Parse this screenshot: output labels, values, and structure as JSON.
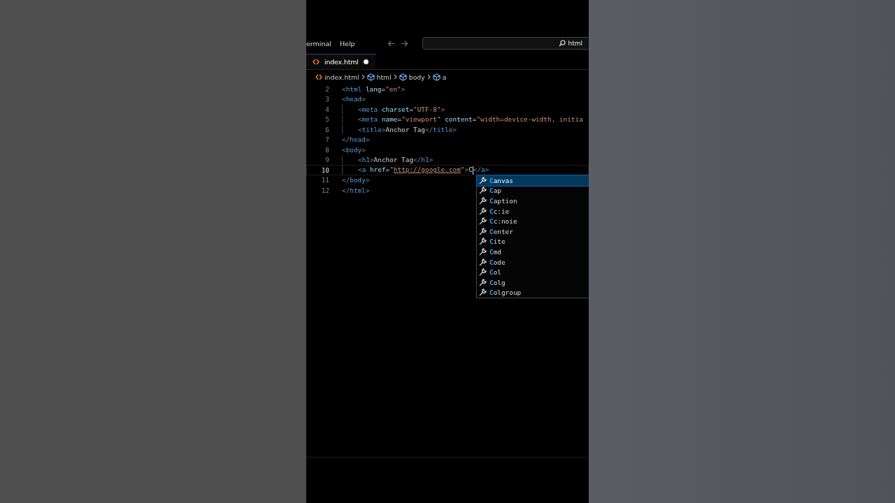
{
  "menu_bar": {
    "items": [
      "erminal",
      "Help"
    ],
    "search": {
      "value": "html"
    }
  },
  "tabs": [
    {
      "label": "index.html",
      "selected": true,
      "modified": true
    }
  ],
  "breadcrumb": [
    {
      "label": "index.html",
      "kind": "file"
    },
    {
      "label": "html",
      "kind": "element"
    },
    {
      "label": "body",
      "kind": "element"
    },
    {
      "label": "a",
      "kind": "element"
    }
  ],
  "code_lines": [
    {
      "number": "2",
      "indent": false,
      "current": false,
      "tokens": [
        {
          "text": "<",
          "kind": "punct"
        },
        {
          "text": "html",
          "kind": "tag"
        },
        {
          "text": " lang",
          "kind": "attr"
        },
        {
          "text": "=",
          "kind": "text"
        },
        {
          "text": "\"en\"",
          "kind": "string"
        },
        {
          "text": ">",
          "kind": "punct"
        }
      ]
    },
    {
      "number": "3",
      "indent": false,
      "current": false,
      "tokens": [
        {
          "text": "<",
          "kind": "punct"
        },
        {
          "text": "head",
          "kind": "tag"
        },
        {
          "text": ">",
          "kind": "punct"
        }
      ]
    },
    {
      "number": "4",
      "indent": true,
      "current": false,
      "tokens": [
        {
          "text": "<",
          "kind": "punct"
        },
        {
          "text": "meta",
          "kind": "tag"
        },
        {
          "text": " charset",
          "kind": "attr"
        },
        {
          "text": "=",
          "kind": "text"
        },
        {
          "text": "\"UTF-8\"",
          "kind": "string"
        },
        {
          "text": ">",
          "kind": "punct"
        }
      ]
    },
    {
      "number": "5",
      "indent": true,
      "current": false,
      "tokens": [
        {
          "text": "<",
          "kind": "punct"
        },
        {
          "text": "meta",
          "kind": "tag"
        },
        {
          "text": " name",
          "kind": "attr"
        },
        {
          "text": "=",
          "kind": "text"
        },
        {
          "text": "\"viewport\"",
          "kind": "string"
        },
        {
          "text": " content",
          "kind": "attr"
        },
        {
          "text": "=",
          "kind": "text"
        },
        {
          "text": "\"width=device-width, initia",
          "kind": "string"
        }
      ]
    },
    {
      "number": "6",
      "indent": true,
      "current": false,
      "tokens": [
        {
          "text": "<",
          "kind": "punct"
        },
        {
          "text": "title",
          "kind": "tag"
        },
        {
          "text": ">",
          "kind": "punct"
        },
        {
          "text": "Anchor Tag",
          "kind": "text"
        },
        {
          "text": "</",
          "kind": "punct"
        },
        {
          "text": "title",
          "kind": "tag"
        },
        {
          "text": ">",
          "kind": "punct"
        }
      ]
    },
    {
      "number": "7",
      "indent": false,
      "current": false,
      "tokens": [
        {
          "text": "</",
          "kind": "punct"
        },
        {
          "text": "head",
          "kind": "tag"
        },
        {
          "text": ">",
          "kind": "punct"
        }
      ]
    },
    {
      "number": "8",
      "indent": false,
      "current": false,
      "tokens": [
        {
          "text": "<",
          "kind": "punct"
        },
        {
          "text": "body",
          "kind": "tag"
        },
        {
          "text": ">",
          "kind": "punct"
        }
      ]
    },
    {
      "number": "9",
      "indent": true,
      "current": false,
      "tokens": [
        {
          "text": "<",
          "kind": "punct"
        },
        {
          "text": "h1",
          "kind": "tag"
        },
        {
          "text": ">",
          "kind": "punct"
        },
        {
          "text": "Anchor Tag",
          "kind": "text"
        },
        {
          "text": "</",
          "kind": "punct"
        },
        {
          "text": "h1",
          "kind": "tag"
        },
        {
          "text": ">",
          "kind": "punct"
        }
      ]
    },
    {
      "number": "10",
      "indent": true,
      "current": true,
      "tokens": [
        {
          "text": "<",
          "kind": "punct"
        },
        {
          "text": "a",
          "kind": "tag"
        },
        {
          "text": " href",
          "kind": "attr"
        },
        {
          "text": "=",
          "kind": "text"
        },
        {
          "text": "\"",
          "kind": "string"
        },
        {
          "text": "http://google.com",
          "kind": "link"
        },
        {
          "text": "\"",
          "kind": "string"
        },
        {
          "text": ">",
          "kind": "punct"
        },
        {
          "text": "C",
          "kind": "text",
          "cursor": true
        },
        {
          "text": "</",
          "kind": "punct"
        },
        {
          "text": "a",
          "kind": "tag"
        },
        {
          "text": ">",
          "kind": "punct"
        }
      ]
    },
    {
      "number": "11",
      "indent": false,
      "current": false,
      "tokens": [
        {
          "text": "</",
          "kind": "punct"
        },
        {
          "text": "body",
          "kind": "tag"
        },
        {
          "text": ">",
          "kind": "punct"
        }
      ]
    },
    {
      "number": "12",
      "indent": false,
      "current": false,
      "tokens": [
        {
          "text": "</",
          "kind": "punct"
        },
        {
          "text": "html",
          "kind": "tag"
        },
        {
          "text": ">",
          "kind": "punct"
        }
      ]
    }
  ],
  "suggestions": [
    {
      "match": "C",
      "rest": "anvas",
      "selected": true
    },
    {
      "match": "C",
      "rest": "ap",
      "selected": false
    },
    {
      "match": "C",
      "rest": "aption",
      "selected": false
    },
    {
      "match": "C",
      "rest": "c:ie",
      "selected": false
    },
    {
      "match": "C",
      "rest": "c:noie",
      "selected": false
    },
    {
      "match": "C",
      "rest": "enter",
      "selected": false
    },
    {
      "match": "C",
      "rest": "ite",
      "selected": false
    },
    {
      "match": "C",
      "rest": "md",
      "selected": false
    },
    {
      "match": "C",
      "rest": "ode",
      "selected": false
    },
    {
      "match": "C",
      "rest": "ol",
      "selected": false
    },
    {
      "match": "C",
      "rest": "olg",
      "selected": false
    },
    {
      "match": "C",
      "rest": "olgroup",
      "selected": false
    }
  ]
}
